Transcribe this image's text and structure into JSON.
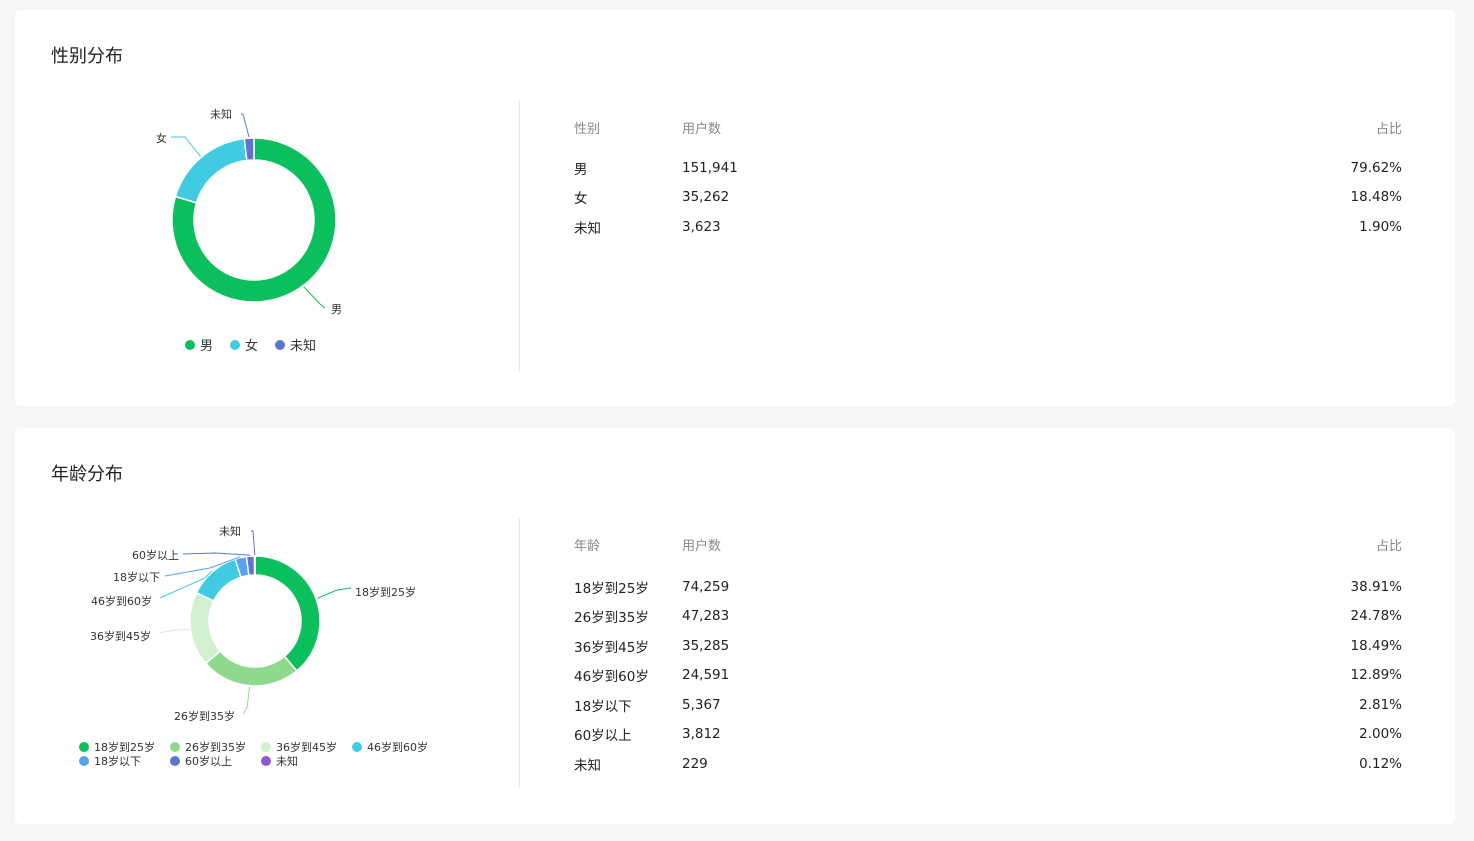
{
  "gender": {
    "title": "性别分布",
    "table": {
      "headers": [
        "性别",
        "用户数",
        "占比"
      ],
      "rows": [
        [
          "男",
          "151,941",
          "79.62%"
        ],
        [
          "女",
          "35,262",
          "18.48%"
        ],
        [
          "未知",
          "3,623",
          "1.90%"
        ]
      ]
    }
  },
  "age": {
    "title": "年龄分布",
    "table": {
      "headers": [
        "年龄",
        "用户数",
        "占比"
      ],
      "rows": [
        [
          "18岁到25岁",
          "74,259",
          "38.91%"
        ],
        [
          "26岁到35岁",
          "47,283",
          "24.78%"
        ],
        [
          "36岁到45岁",
          "35,285",
          "18.49%"
        ],
        [
          "46岁到60岁",
          "24,591",
          "12.89%"
        ],
        [
          "18岁以下",
          "5,367",
          "2.81%"
        ],
        [
          "60岁以上",
          "3,812",
          "2.00%"
        ],
        [
          "未知",
          "229",
          "0.12%"
        ]
      ]
    }
  },
  "chart_data": [
    {
      "type": "pie",
      "donut": true,
      "legend_position": "bottom",
      "categories": [
        "男",
        "女",
        "未知"
      ],
      "values": [
        79.62,
        18.48,
        1.9
      ],
      "colors": [
        "#0bbf5c",
        "#40cbe3",
        "#5f74cf"
      ]
    },
    {
      "type": "pie",
      "donut": true,
      "legend_position": "bottom",
      "categories": [
        "18岁到25岁",
        "26岁到35岁",
        "36岁到45岁",
        "46岁到60岁",
        "18岁以下",
        "60岁以上",
        "未知"
      ],
      "values": [
        38.91,
        24.78,
        18.49,
        12.89,
        2.81,
        2.0,
        0.12
      ],
      "colors": [
        "#0bbf5c",
        "#8fd98f",
        "#d0f0d0",
        "#40cbe3",
        "#55a4ef",
        "#5f74cf",
        "#8e5bd4"
      ]
    }
  ]
}
